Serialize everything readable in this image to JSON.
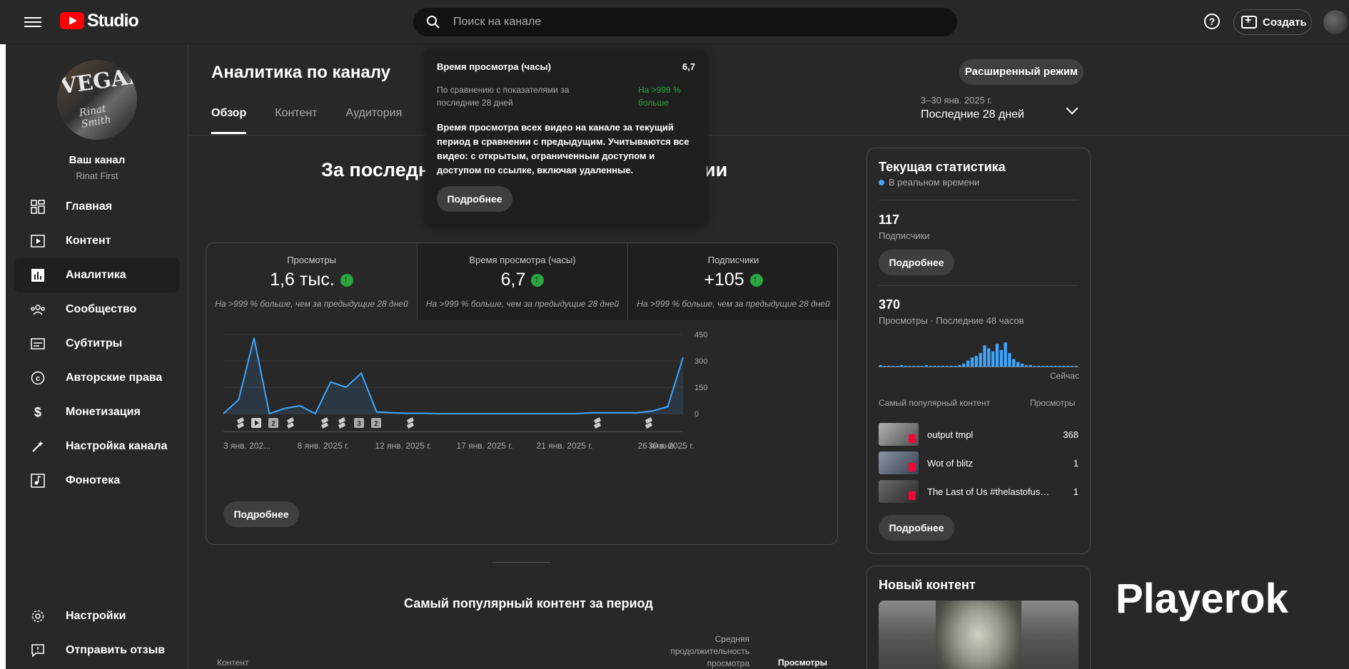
{
  "app": {
    "logo_text": "Studio",
    "brand_color": "#ff0000",
    "accent": "#3ea6ff",
    "positive": "#2ba640"
  },
  "search": {
    "placeholder": "Поиск на канале"
  },
  "header": {
    "create_label": "Создать",
    "help_icon": "help-icon"
  },
  "channel": {
    "name": "Ваш канал",
    "handle": "Rinat First",
    "avatar_text": "VEGAN",
    "avatar_signature": "Rinat Smith"
  },
  "nav": {
    "items": [
      {
        "label": "Главная",
        "icon": "dashboard-icon"
      },
      {
        "label": "Контент",
        "icon": "content-icon"
      },
      {
        "label": "Аналитика",
        "icon": "analytics-icon",
        "active": true
      },
      {
        "label": "Сообщество",
        "icon": "community-icon"
      },
      {
        "label": "Субтитры",
        "icon": "subtitles-icon"
      },
      {
        "label": "Авторские права",
        "icon": "copyright-icon"
      },
      {
        "label": "Монетизация",
        "icon": "monetization-icon"
      },
      {
        "label": "Настройка канала",
        "icon": "customization-icon"
      },
      {
        "label": "Фонотека",
        "icon": "audio-library-icon"
      }
    ],
    "bottom": [
      {
        "label": "Настройки",
        "icon": "settings-icon"
      },
      {
        "label": "Отправить отзыв",
        "icon": "feedback-icon"
      }
    ]
  },
  "page": {
    "title": "Аналитика по каналу",
    "tabs": [
      "Обзор",
      "Контент",
      "Аудитория"
    ],
    "advanced_button": "Расширенный режим",
    "date_range": "3–30 янв. 2025 г.",
    "period": "Последние 28 дней",
    "heading_left": "За последн",
    "heading_right": "ии"
  },
  "metrics": [
    {
      "label": "Просмотры",
      "value": "1,6 тыс.",
      "comparison": "На >999 % больше, чем за предыдущие 28 дней"
    },
    {
      "label": "Время просмотра (часы)",
      "value": "6,7",
      "comparison": "На >999 % больше, чем за предыдущие 28 дней"
    },
    {
      "label": "Подписчики",
      "value": "+105",
      "comparison": "На >999 % больше, чем за предыдущие 28 дней"
    }
  ],
  "chart_data": {
    "type": "area",
    "series": [
      {
        "values": [
          0,
          80,
          430,
          0,
          30,
          45,
          0,
          180,
          150,
          230,
          10,
          5,
          2,
          2,
          0,
          0,
          0,
          0,
          0,
          0,
          0,
          0,
          0,
          0,
          5,
          5,
          5,
          5,
          15,
          40,
          320
        ]
      }
    ],
    "y_ticks": [
      "450",
      "300",
      "150",
      "0"
    ],
    "ylim": [
      0,
      450
    ],
    "x_labels": [
      "3 янв. 202...",
      "8 янв. 2025 г.",
      "12 янв. 2025 г.",
      "17 янв. 2025 г.",
      "21 янв. 2025 г.",
      "26 янв. 2025 г.",
      "30 янв. ..."
    ],
    "markers": [
      "shorts",
      "video",
      "2",
      "shorts",
      "shorts",
      "shorts",
      "3",
      "2",
      "shorts",
      "shorts",
      "shorts"
    ],
    "color": "#3ea6ff"
  },
  "card": {
    "more_button": "Подробнее"
  },
  "popular": {
    "heading": "Самый популярный контент за период",
    "col_content": "Контент",
    "col_avg": "Средняя продолжительность просмотра",
    "col_views": "Просмотры"
  },
  "tooltip": {
    "metric": "Время просмотра (часы)",
    "value": "6,7",
    "compare_label": "По сравнению с показателями за последние 28 дней",
    "compare_value": "На >999 % больше",
    "description": "Время просмотра всех видео на канале за текущий период в сравнении с предыдущим. Учитываются все видео: с открытым, ограниченным доступом и доступом по ссылке, включая удаленные.",
    "button": "Подробнее"
  },
  "realtime": {
    "title": "Текущая статистика",
    "live": "В реальном времени",
    "subscribers_value": "117",
    "subscribers_label": "Подписчики",
    "subscribers_button": "Подробнее",
    "views_value": "370",
    "views_label": "Просмотры · Последние 48 часов",
    "spark": [
      1,
      0,
      0,
      0,
      0,
      1,
      0,
      0,
      0,
      0,
      0,
      1,
      0,
      0,
      0,
      0,
      0,
      0,
      0,
      1,
      2,
      4,
      6,
      7,
      9,
      14,
      12,
      10,
      15,
      11,
      16,
      9,
      5,
      3,
      2,
      1,
      1,
      0,
      0,
      0,
      0,
      0,
      0,
      0,
      0,
      0,
      0,
      0
    ],
    "now_label": "Сейчас",
    "top_content_label": "Самый популярный контент",
    "top_views_label": "Просмотры",
    "items": [
      {
        "title": "output tmpl",
        "views": "368"
      },
      {
        "title": "Wot of blitz",
        "views": "1"
      },
      {
        "title": "The Last of Us #thelastofus #...",
        "views": "1"
      }
    ],
    "more_button": "Подробнее"
  },
  "new_content": {
    "title": "Новый контент"
  },
  "watermark": "Playerok"
}
